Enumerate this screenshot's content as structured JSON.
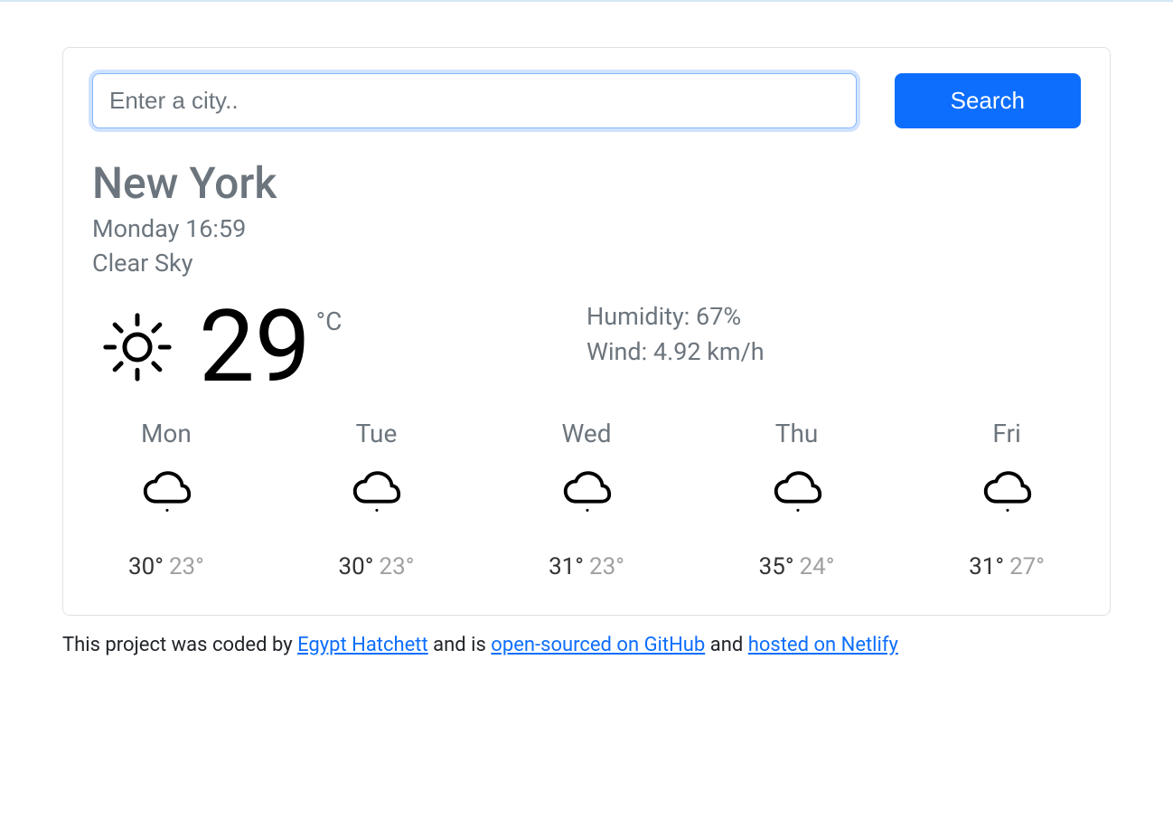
{
  "search": {
    "placeholder": "Enter a city..",
    "button_label": "Search"
  },
  "overview": {
    "city": "New York",
    "datetime": "Monday 16:59",
    "description": "Clear Sky"
  },
  "current": {
    "temp": "29",
    "unit": "°C",
    "humidity_label": "Humidity: ",
    "humidity_value": "67%",
    "wind_label": "Wind: ",
    "wind_value": "4.92 km/h"
  },
  "forecast": [
    {
      "day": "Mon",
      "high": "30°",
      "low": "23°"
    },
    {
      "day": "Tue",
      "high": "30°",
      "low": "23°"
    },
    {
      "day": "Wed",
      "high": "31°",
      "low": "23°"
    },
    {
      "day": "Thu",
      "high": "35°",
      "low": "24°"
    },
    {
      "day": "Fri",
      "high": "31°",
      "low": "27°"
    }
  ],
  "footer": {
    "prefix": "This project was coded by ",
    "author": "Egypt Hatchett",
    "mid1": " and is ",
    "link_github": "open-sourced on GitHub",
    "mid2": " and ",
    "link_netlify": "hosted on Netlify"
  }
}
